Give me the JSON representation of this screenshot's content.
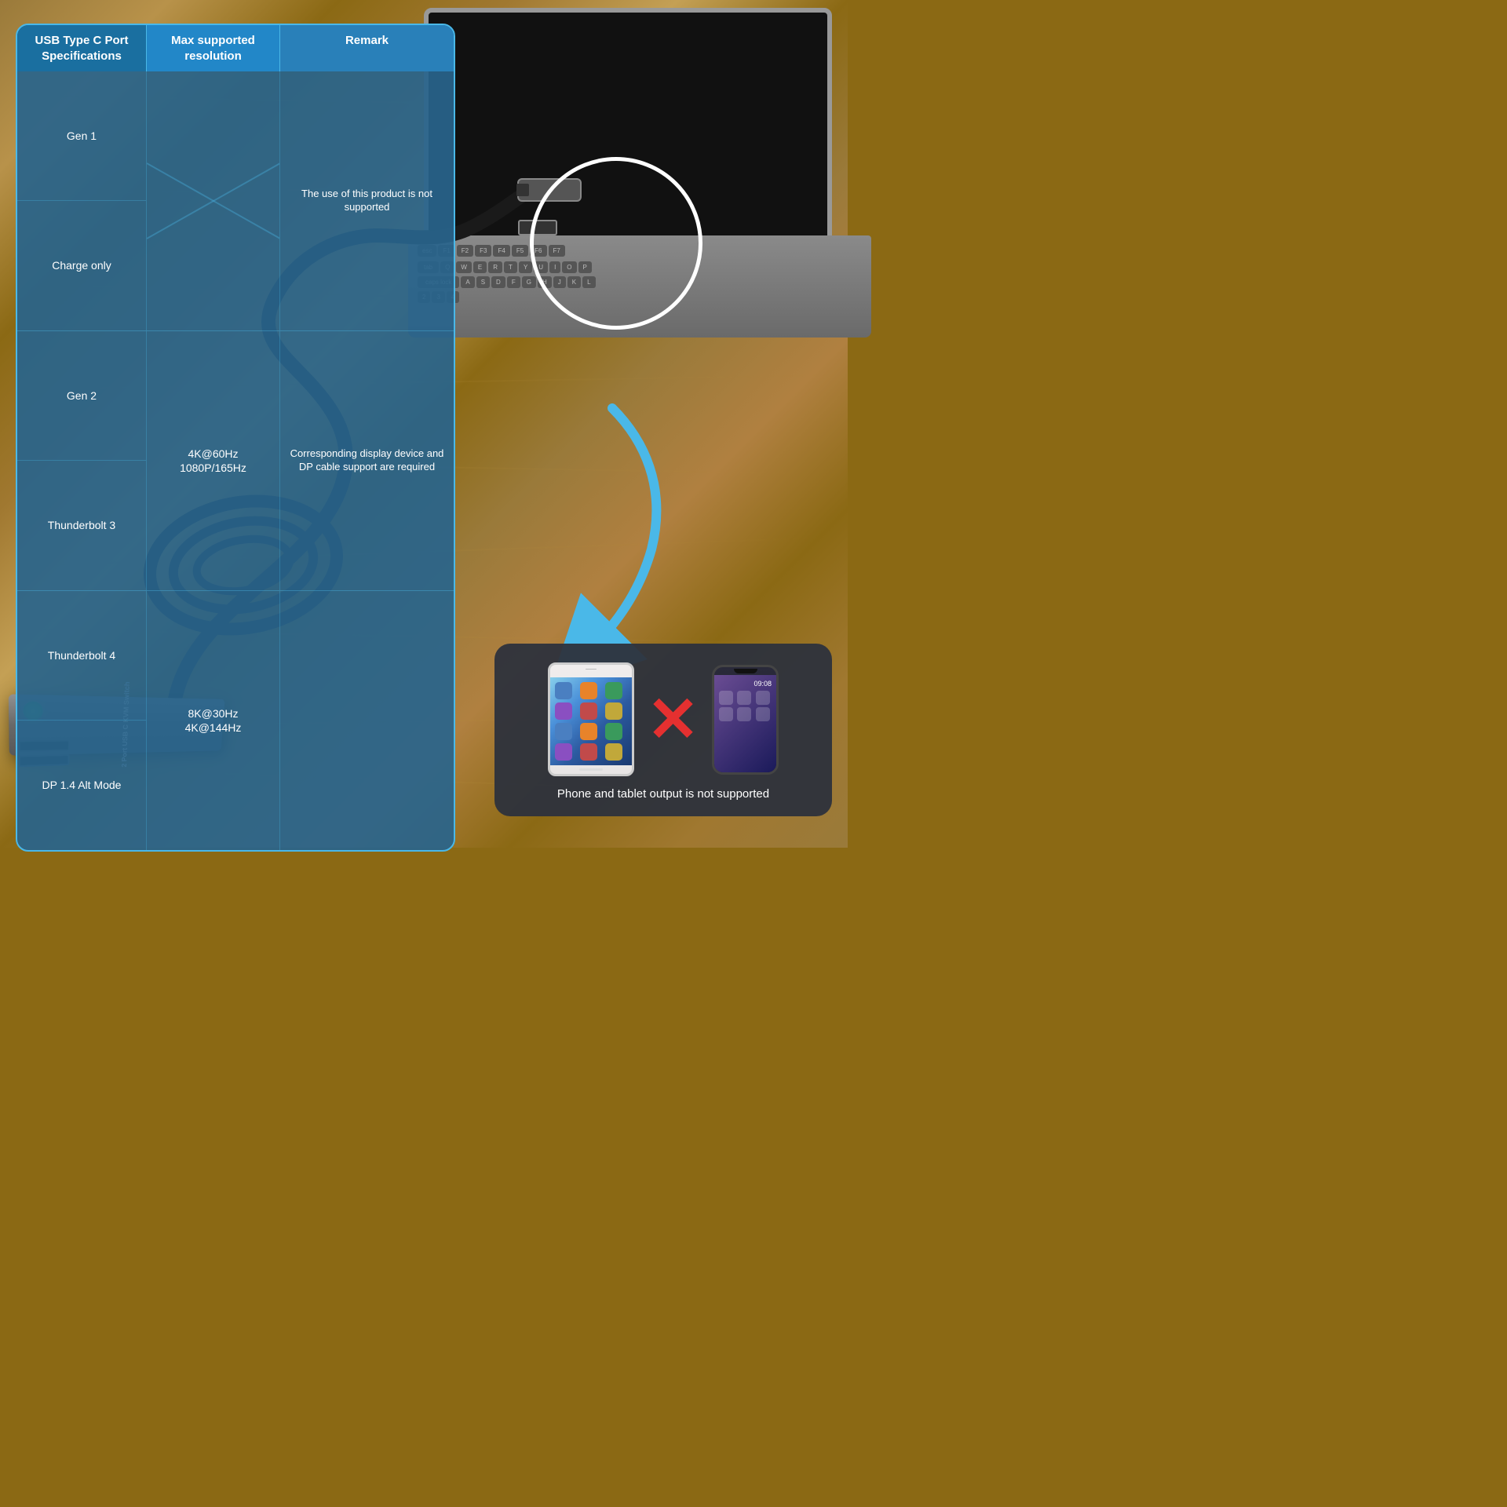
{
  "background": {
    "color": "#8B6914"
  },
  "table": {
    "header": {
      "col1": "USB Type C Port\nSpecifications",
      "col2": "Max supported\nresolution",
      "col3": "Remark"
    },
    "rows": [
      {
        "spec": "Gen 1",
        "resolution": "",
        "remark": "The use of this product is not supported",
        "rowspan": 2,
        "empty": true
      },
      {
        "spec": "Charge only",
        "resolution": "",
        "remark": "",
        "empty": true
      },
      {
        "spec": "Gen 2",
        "resolution": "4K@60Hz\n1080P/165Hz",
        "remark": "Corresponding display device and DP cable support are required",
        "rowspan": 2
      },
      {
        "spec": "Thunderbolt 3",
        "resolution": "",
        "remark": ""
      },
      {
        "spec": "Thunderbolt 4",
        "resolution": "8K@30Hz\n4K@144Hz",
        "remark": "",
        "rowspan": 2
      },
      {
        "spec": "DP  1.4 Alt Mode",
        "resolution": "",
        "remark": ""
      }
    ]
  },
  "kvm": {
    "label": "2 Port USB C KVM Switch"
  },
  "warning": {
    "text": "Phone and tablet output is not supported",
    "x_symbol": "✕",
    "phone_time": "09:08"
  },
  "circle_note": {
    "description": "USB Type-C port connection circle highlight"
  },
  "arrow": {
    "symbol": "↓",
    "color": "#5bc8f5"
  }
}
